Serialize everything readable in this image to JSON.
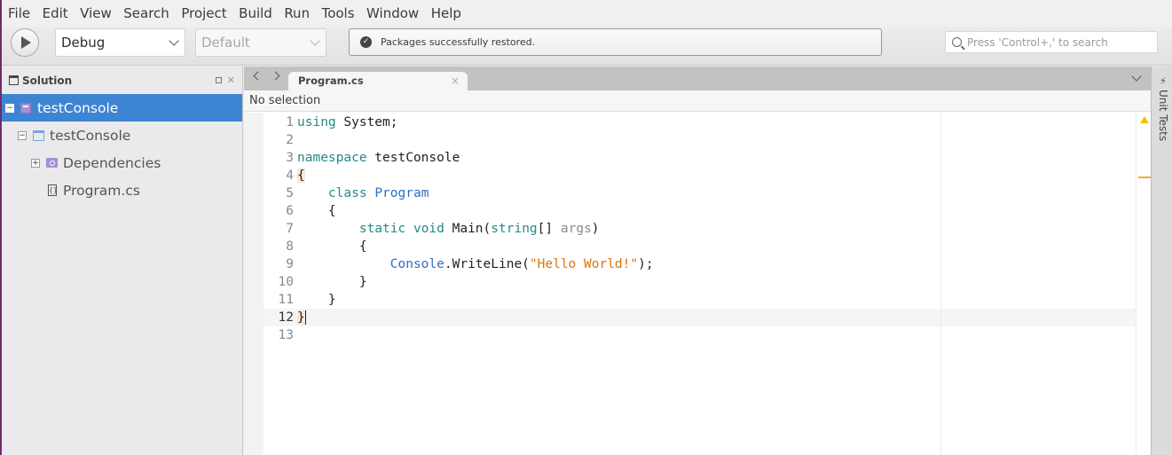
{
  "menu": [
    "File",
    "Edit",
    "View",
    "Search",
    "Project",
    "Build",
    "Run",
    "Tools",
    "Window",
    "Help"
  ],
  "toolbar": {
    "run_icon": "play-icon",
    "configuration": "Debug",
    "platform": "Default",
    "status": "Packages successfully restored.",
    "status_icon": "check-circle-icon",
    "search_placeholder": "Press 'Control+,' to search"
  },
  "solution_pad": {
    "title": "Solution",
    "tree": [
      {
        "label": "testConsole",
        "kind": "solution",
        "expander": "−",
        "selected": true
      },
      {
        "label": "testConsole",
        "kind": "project",
        "expander": "−"
      },
      {
        "label": "Dependencies",
        "kind": "folder",
        "expander": "+"
      },
      {
        "label": "Program.cs",
        "kind": "file",
        "file_glyph": "{}"
      }
    ]
  },
  "editor": {
    "tab_label": "Program.cs",
    "tab_close": "×",
    "path_bar": "No selection",
    "current_line": 12,
    "lines": [
      {
        "n": "1",
        "text": "using System;"
      },
      {
        "n": "2",
        "text": ""
      },
      {
        "n": "3",
        "text": "namespace testConsole"
      },
      {
        "n": "4",
        "text": "{"
      },
      {
        "n": "5",
        "text": "    class Program"
      },
      {
        "n": "6",
        "text": "    {"
      },
      {
        "n": "7",
        "text": "        static void Main(string[] args)"
      },
      {
        "n": "8",
        "text": "        {"
      },
      {
        "n": "9",
        "text": "            Console.WriteLine(\"Hello World!\");"
      },
      {
        "n": "10",
        "text": "        }"
      },
      {
        "n": "11",
        "text": "    }"
      },
      {
        "n": "12",
        "text": "}"
      },
      {
        "n": "13",
        "text": ""
      }
    ]
  },
  "dock": {
    "label": "Unit Tests",
    "icon": "bolt-icon"
  },
  "colors": {
    "selection": "#3d85d3",
    "keyword": "#1f8a8a",
    "type": "#2d6ebf",
    "string": "#d9750d",
    "warning": "#f2c300"
  }
}
